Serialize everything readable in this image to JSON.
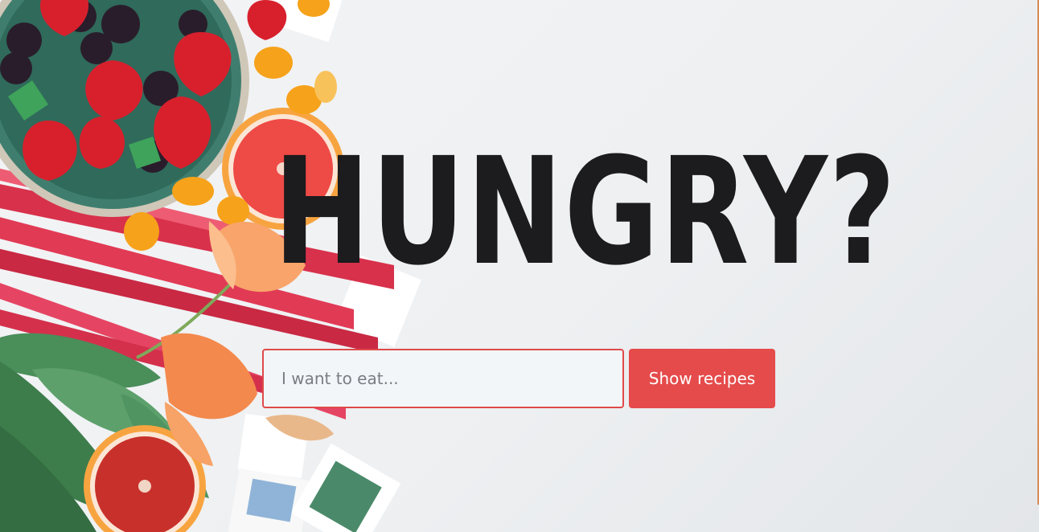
{
  "hero": {
    "headline": "HUNGRY?",
    "image_description": "food-flatlay-photo"
  },
  "search": {
    "placeholder": "I want to eat...",
    "value": "",
    "button_label": "Show recipes"
  },
  "colors": {
    "accent": "#e54b4b",
    "headline": "#1c1b1d",
    "background": "#f0f2f4"
  }
}
